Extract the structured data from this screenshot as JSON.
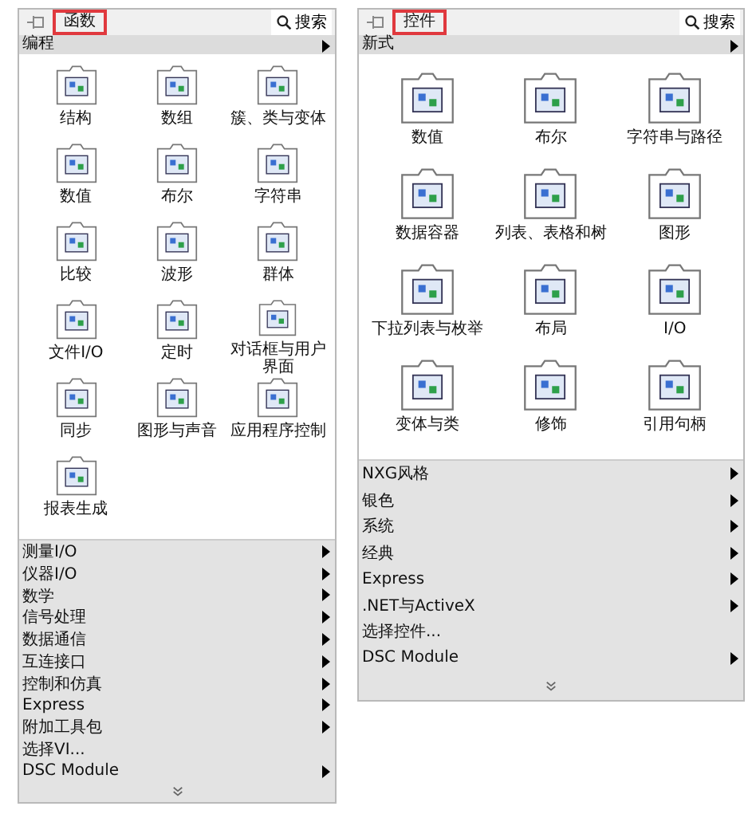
{
  "palettes": [
    {
      "title": "函数",
      "search": "搜索",
      "section": "编程",
      "items": [
        "结构",
        "数组",
        "簇、类与变体",
        "数值",
        "布尔",
        "字符串",
        "比较",
        "波形",
        "群体",
        "文件I/O",
        "定时",
        "对话框与用户界面",
        "同步",
        "图形与声音",
        "应用程序控制",
        "报表生成"
      ],
      "menu": [
        {
          "label": "测量I/O",
          "submenu": true
        },
        {
          "label": "仪器I/O",
          "submenu": true
        },
        {
          "label": "数学",
          "submenu": true
        },
        {
          "label": "信号处理",
          "submenu": true
        },
        {
          "label": "数据通信",
          "submenu": true
        },
        {
          "label": "互连接口",
          "submenu": true
        },
        {
          "label": "控制和仿真",
          "submenu": true
        },
        {
          "label": "Express",
          "submenu": true
        },
        {
          "label": "附加工具包",
          "submenu": true
        },
        {
          "label": "选择VI...",
          "submenu": false
        },
        {
          "label": "DSC Module",
          "submenu": true
        }
      ]
    },
    {
      "title": "控件",
      "search": "搜索",
      "section": "新式",
      "items": [
        "数值",
        "布尔",
        "字符串与路径",
        "数据容器",
        "列表、表格和树",
        "图形",
        "下拉列表与枚举",
        "布局",
        "I/O",
        "变体与类",
        "修饰",
        "引用句柄"
      ],
      "menu": [
        {
          "label": "NXG风格",
          "submenu": true
        },
        {
          "label": "银色",
          "submenu": true
        },
        {
          "label": "系统",
          "submenu": true
        },
        {
          "label": "经典",
          "submenu": true
        },
        {
          "label": "Express",
          "submenu": true
        },
        {
          "label": ".NET与ActiveX",
          "submenu": true
        },
        {
          "label": "选择控件...",
          "submenu": false
        },
        {
          "label": "DSC Module",
          "submenu": true
        }
      ]
    }
  ]
}
